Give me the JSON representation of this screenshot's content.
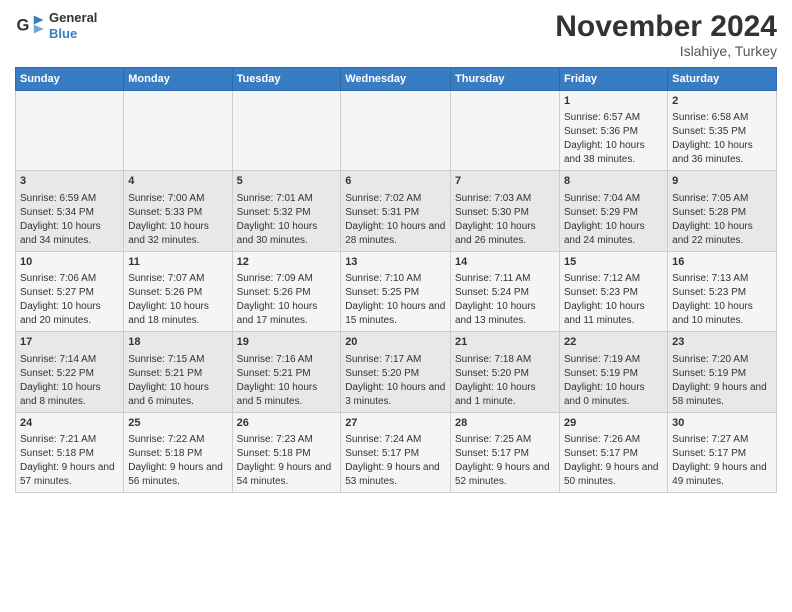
{
  "logo": {
    "line1": "General",
    "line2": "Blue"
  },
  "title": "November 2024",
  "subtitle": "Islahiye, Turkey",
  "days_of_week": [
    "Sunday",
    "Monday",
    "Tuesday",
    "Wednesday",
    "Thursday",
    "Friday",
    "Saturday"
  ],
  "weeks": [
    [
      {
        "day": "",
        "content": ""
      },
      {
        "day": "",
        "content": ""
      },
      {
        "day": "",
        "content": ""
      },
      {
        "day": "",
        "content": ""
      },
      {
        "day": "",
        "content": ""
      },
      {
        "day": "1",
        "content": "Sunrise: 6:57 AM\nSunset: 5:36 PM\nDaylight: 10 hours and 38 minutes."
      },
      {
        "day": "2",
        "content": "Sunrise: 6:58 AM\nSunset: 5:35 PM\nDaylight: 10 hours and 36 minutes."
      }
    ],
    [
      {
        "day": "3",
        "content": "Sunrise: 6:59 AM\nSunset: 5:34 PM\nDaylight: 10 hours and 34 minutes."
      },
      {
        "day": "4",
        "content": "Sunrise: 7:00 AM\nSunset: 5:33 PM\nDaylight: 10 hours and 32 minutes."
      },
      {
        "day": "5",
        "content": "Sunrise: 7:01 AM\nSunset: 5:32 PM\nDaylight: 10 hours and 30 minutes."
      },
      {
        "day": "6",
        "content": "Sunrise: 7:02 AM\nSunset: 5:31 PM\nDaylight: 10 hours and 28 minutes."
      },
      {
        "day": "7",
        "content": "Sunrise: 7:03 AM\nSunset: 5:30 PM\nDaylight: 10 hours and 26 minutes."
      },
      {
        "day": "8",
        "content": "Sunrise: 7:04 AM\nSunset: 5:29 PM\nDaylight: 10 hours and 24 minutes."
      },
      {
        "day": "9",
        "content": "Sunrise: 7:05 AM\nSunset: 5:28 PM\nDaylight: 10 hours and 22 minutes."
      }
    ],
    [
      {
        "day": "10",
        "content": "Sunrise: 7:06 AM\nSunset: 5:27 PM\nDaylight: 10 hours and 20 minutes."
      },
      {
        "day": "11",
        "content": "Sunrise: 7:07 AM\nSunset: 5:26 PM\nDaylight: 10 hours and 18 minutes."
      },
      {
        "day": "12",
        "content": "Sunrise: 7:09 AM\nSunset: 5:26 PM\nDaylight: 10 hours and 17 minutes."
      },
      {
        "day": "13",
        "content": "Sunrise: 7:10 AM\nSunset: 5:25 PM\nDaylight: 10 hours and 15 minutes."
      },
      {
        "day": "14",
        "content": "Sunrise: 7:11 AM\nSunset: 5:24 PM\nDaylight: 10 hours and 13 minutes."
      },
      {
        "day": "15",
        "content": "Sunrise: 7:12 AM\nSunset: 5:23 PM\nDaylight: 10 hours and 11 minutes."
      },
      {
        "day": "16",
        "content": "Sunrise: 7:13 AM\nSunset: 5:23 PM\nDaylight: 10 hours and 10 minutes."
      }
    ],
    [
      {
        "day": "17",
        "content": "Sunrise: 7:14 AM\nSunset: 5:22 PM\nDaylight: 10 hours and 8 minutes."
      },
      {
        "day": "18",
        "content": "Sunrise: 7:15 AM\nSunset: 5:21 PM\nDaylight: 10 hours and 6 minutes."
      },
      {
        "day": "19",
        "content": "Sunrise: 7:16 AM\nSunset: 5:21 PM\nDaylight: 10 hours and 5 minutes."
      },
      {
        "day": "20",
        "content": "Sunrise: 7:17 AM\nSunset: 5:20 PM\nDaylight: 10 hours and 3 minutes."
      },
      {
        "day": "21",
        "content": "Sunrise: 7:18 AM\nSunset: 5:20 PM\nDaylight: 10 hours and 1 minute."
      },
      {
        "day": "22",
        "content": "Sunrise: 7:19 AM\nSunset: 5:19 PM\nDaylight: 10 hours and 0 minutes."
      },
      {
        "day": "23",
        "content": "Sunrise: 7:20 AM\nSunset: 5:19 PM\nDaylight: 9 hours and 58 minutes."
      }
    ],
    [
      {
        "day": "24",
        "content": "Sunrise: 7:21 AM\nSunset: 5:18 PM\nDaylight: 9 hours and 57 minutes."
      },
      {
        "day": "25",
        "content": "Sunrise: 7:22 AM\nSunset: 5:18 PM\nDaylight: 9 hours and 56 minutes."
      },
      {
        "day": "26",
        "content": "Sunrise: 7:23 AM\nSunset: 5:18 PM\nDaylight: 9 hours and 54 minutes."
      },
      {
        "day": "27",
        "content": "Sunrise: 7:24 AM\nSunset: 5:17 PM\nDaylight: 9 hours and 53 minutes."
      },
      {
        "day": "28",
        "content": "Sunrise: 7:25 AM\nSunset: 5:17 PM\nDaylight: 9 hours and 52 minutes."
      },
      {
        "day": "29",
        "content": "Sunrise: 7:26 AM\nSunset: 5:17 PM\nDaylight: 9 hours and 50 minutes."
      },
      {
        "day": "30",
        "content": "Sunrise: 7:27 AM\nSunset: 5:17 PM\nDaylight: 9 hours and 49 minutes."
      }
    ]
  ]
}
